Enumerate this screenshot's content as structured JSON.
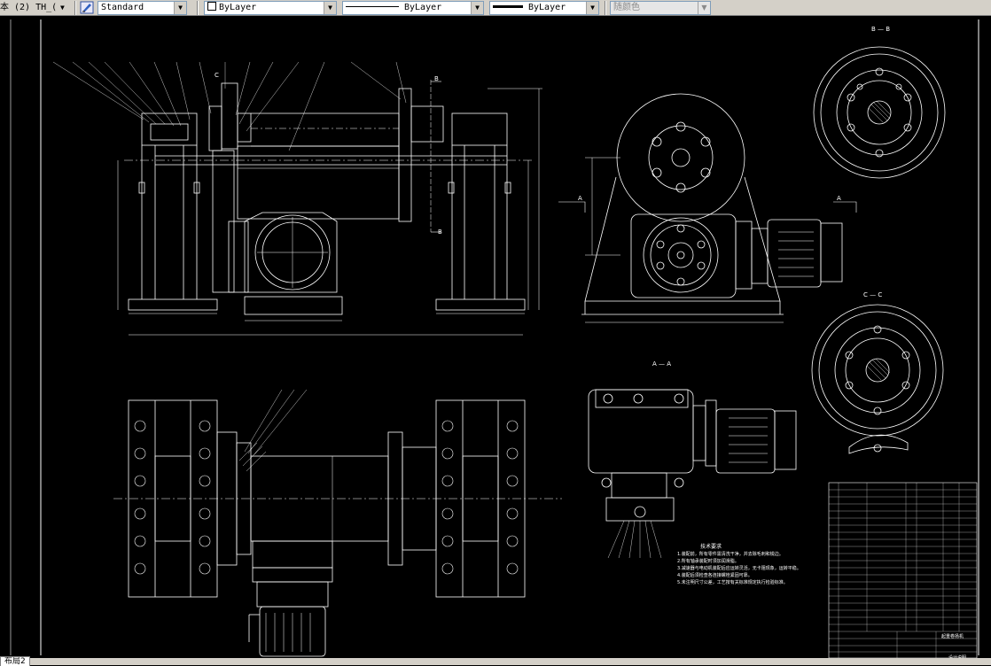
{
  "toolbar": {
    "text_style_name": "本 (2) TH_(",
    "text_style": "Standard",
    "layer": "ByLayer",
    "linetype": "ByLayer",
    "lineweight": "ByLayer",
    "plot_style": "随颜色",
    "plot_style_disabled": true
  },
  "drawing": {
    "title_block_name": "起重卷扬机",
    "title_block_sheet": "设计说明",
    "section_labels": {
      "bb": "B — B",
      "cc": "C — C",
      "aa": "A — A",
      "a_left": "A",
      "a_right": "A",
      "b_top": "B",
      "b_bottom": "B",
      "c_top": "C"
    },
    "tech_notes_title": "技术要求",
    "tech_notes": [
      "1.装配前，所有零件需清洗干净，并去除毛刺和锐边。",
      "2.所有轴承装配时须加润滑脂。",
      "3.减速器与电动机装配后应运转灵活，无卡阻现象，运转平稳。",
      "4.装配后须检查各连接螺栓紧固可靠。",
      "5.未注明尺寸公差，工艺按有关标准规定执行检验标准。"
    ]
  },
  "tabs": {
    "active": "布局2"
  },
  "colors": {
    "background": "#000000",
    "lines": "#ffffff",
    "toolbar": "#d4d0c8"
  }
}
